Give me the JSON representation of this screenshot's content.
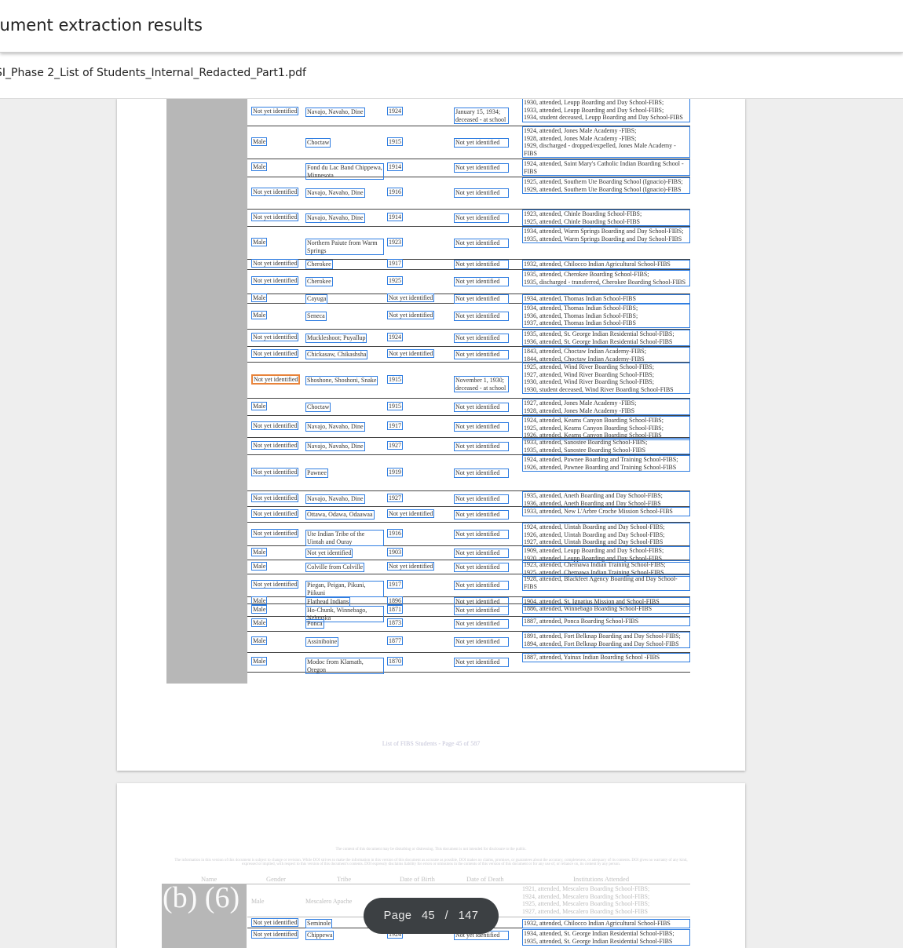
{
  "app": {
    "title": "cument extraction results"
  },
  "file": {
    "name": "SI_Phase 2_List of Students_Internal_Redacted_Part1.pdf"
  },
  "page1": {
    "rows": [
      {
        "gender": "Not yet identified",
        "tribe": "Navajo, Navaho, Dine",
        "birth": "1924",
        "death": "January 15, 1934; deceased - at school",
        "inst": [
          "1930, attended, Leupp Boarding and Day School-FIBS;",
          "1933, attended, Leupp Boarding and Day School-FIBS;",
          "1934, student deceased, Leupp Boarding and Day School-FIBS"
        ]
      },
      {
        "gender": "Male",
        "tribe": "Choctaw",
        "birth": "1915",
        "death": "Not yet identified",
        "inst": [
          "1924, attended, Jones Male Academy -FIBS;",
          "1928, attended, Jones Male Academy -FIBS;",
          "1929, discharged - dropped/expelled, Jones Male Academy -FIBS"
        ]
      },
      {
        "gender": "Male",
        "tribe": "Fond du Lac Band Chippewa, Minnesota",
        "birth": "1914",
        "death": "Not yet identified",
        "inst": [
          "1924, attended, Saint Mary's Catholic Indian Boarding School -FIBS"
        ]
      },
      {
        "gender": "Not yet identified",
        "tribe": "Navajo, Navaho, Dine",
        "birth": "1916",
        "death": "Not yet identified",
        "inst": [
          "1925, attended, Southern Ute Boarding School (Ignacio)-FIBS;",
          "1929, attended, Southern Ute Boarding School (Ignacio)-FIBS"
        ]
      },
      {
        "gender": "Not yet identified",
        "tribe": "Navajo, Navaho, Dine",
        "birth": "1914",
        "death": "Not yet identified",
        "inst": [
          "1923, attended, Chinle Boarding School-FIBS;",
          "1925, attended, Chinle Boarding School-FIBS"
        ]
      },
      {
        "gender": "Male",
        "tribe": "Northern Paiute from Warm Springs",
        "birth": "1923",
        "death": "Not yet identified",
        "inst": [
          "1934, attended, Warm Springs Boarding and Day School-FIBS;",
          "1935, attended, Warm Springs Boarding and Day School-FIBS"
        ]
      },
      {
        "gender": "Not yet identified",
        "tribe": "Cherokee",
        "birth": "1917",
        "death": "Not yet identified",
        "inst": [
          "1932, attended, Chilocco Indian Agricultural School-FIBS"
        ]
      },
      {
        "gender": "Not yet identified",
        "tribe": "Cherokee",
        "birth": "1925",
        "death": "Not yet identified",
        "inst": [
          "1935, attended, Cherokee Boarding School-FIBS;",
          "1935, discharged - transferred, Cherokee Boarding School-FIBS"
        ]
      },
      {
        "gender": "Male",
        "tribe": "Cayuga",
        "birth": "Not yet identified",
        "death": "Not yet identified",
        "inst": [
          "1934, attended, Thomas Indian School-FIBS"
        ]
      },
      {
        "gender": "Male",
        "tribe": "Seneca",
        "birth": "Not yet identified",
        "death": "Not yet identified",
        "inst": [
          "1934, attended, Thomas Indian School-FIBS;",
          "1936, attended, Thomas Indian School-FIBS;",
          "1937, attended, Thomas Indian School-FIBS"
        ]
      },
      {
        "gender": "Not yet identified",
        "tribe": "Muckleshoot; Puyallup",
        "birth": "1924",
        "death": "Not yet identified",
        "inst": [
          "1935, attended, St. George Indian Residential School-FIBS;",
          "1936, attended, St. George Indian Residential School-FIBS"
        ]
      },
      {
        "gender": "Not yet identified",
        "tribe": "Chickasaw, Chikashsha",
        "birth": "Not yet identified",
        "death": "Not yet identified",
        "inst": [
          "1843, attended, Choctaw Indian Academy-FIBS;",
          "1844, attended, Choctaw Indian Academy-FIBS"
        ]
      },
      {
        "gender": "Not yet identified",
        "tribe": "Shoshone, Shoshoni, Snake",
        "birth": "1915",
        "death": "November 1, 1930; deceased - at school",
        "inst": [
          "1925, attended, Wind River Boarding School-FIBS;",
          "1927, attended, Wind River Boarding School-FIBS;",
          "1930, attended, Wind River Boarding School-FIBS;",
          "1930, student deceased, Wind River Boarding School-FIBS"
        ]
      },
      {
        "gender": "Male",
        "tribe": "Choctaw",
        "birth": "1915",
        "death": "Not yet identified",
        "inst": [
          "1927, attended, Jones Male Academy -FIBS;",
          "1928, attended, Jones Male Academy -FIBS"
        ]
      },
      {
        "gender": "Not yet identified",
        "tribe": "Navajo, Navaho, Dine",
        "birth": "1917",
        "death": "Not yet identified",
        "inst": [
          "1924, attended, Keams Canyon Boarding School-FIBS;",
          "1925, attended, Keams Canyon Boarding School-FIBS;",
          "1926, attended, Keams Canyon Boarding School-FIBS"
        ]
      },
      {
        "gender": "Not yet identified",
        "tribe": "Navajo, Navaho, Dine",
        "birth": "1927",
        "death": "Not yet identified",
        "inst": [
          "1933, attended, Sanostee Boarding School-FIBS;",
          "1935, attended, Sanostee Boarding School-FIBS"
        ]
      },
      {
        "gender": "Not yet identified",
        "tribe": "Pawnee",
        "birth": "1919",
        "death": "Not yet identified",
        "inst": [
          "1924, attended, Pawnee Boarding and Training School-FIBS;",
          "1926, attended, Pawnee Boarding and Training School-FIBS"
        ]
      },
      {
        "gender": "Not yet identified",
        "tribe": "Navajo, Navaho, Dine",
        "birth": "1927",
        "death": "Not yet identified",
        "inst": [
          "1935, attended, Aneth Boarding and Day School-FIBS;",
          "1936, attended, Aneth Boarding and Day School-FIBS"
        ]
      },
      {
        "gender": "Not yet identified",
        "tribe": "Ottawa, Odawa, Odaawaa",
        "birth": "Not yet identified",
        "death": "Not yet identified",
        "inst": [
          "1933, attended, New L'Arbre Croche Mission School-FIBS"
        ]
      },
      {
        "gender": "Not yet identified",
        "tribe": "Ute Indian Tribe of the Uintah and Ouray",
        "birth": "1916",
        "death": "Not yet identified",
        "inst": [
          "1924, attended, Uintah Boarding and Day School-FIBS;",
          "1926, attended, Uintah Boarding and Day School-FIBS;",
          "1927, attended, Uintah Boarding and Day School-FIBS"
        ]
      },
      {
        "gender": "Male",
        "tribe": "Not yet identified",
        "birth": "1903",
        "death": "Not yet identified",
        "inst": [
          "1909, attended, Leupp Boarding and Day School-FIBS;",
          "1920, attended, Leupp Boarding and Day School-FIBS"
        ]
      },
      {
        "gender": "Male",
        "tribe": "Colville from Colville",
        "birth": "Not yet identified",
        "death": "Not yet identified",
        "inst": [
          "1923, attended, Chemawa Indian Training School-FIBS;",
          "1925, attended, Chemawa Indian Training School-FIBS"
        ]
      },
      {
        "gender": "Not yet identified",
        "tribe": "Piegan, Peigan, Pikuni, Piikuni",
        "birth": "1917",
        "death": "Not yet identified",
        "inst": [
          "1928, attended, Blackfeet Agency Boarding and Day School-FIBS"
        ]
      },
      {
        "gender": "Male",
        "tribe": "Flathead Indians",
        "birth": "1896",
        "death": "Not yet identified",
        "inst": [
          "1904, attended, St. Ignatius Mission and School-FIBS"
        ]
      },
      {
        "gender": "Male",
        "tribe": "Ho-Chunk, Winnebago, Nebraska",
        "birth": "1871",
        "death": "Not yet identified",
        "inst": [
          "1886, attended, Winnebago Boarding School-FIBS"
        ]
      },
      {
        "gender": "Male",
        "tribe": "Ponca",
        "birth": "1873",
        "death": "Not yet identified",
        "inst": [
          "1887, attended, Ponca Boarding School-FIBS"
        ]
      },
      {
        "gender": "Male",
        "tribe": "Assiniboine",
        "birth": "1877",
        "death": "Not yet identified",
        "inst": [
          "1891, attended, Fort Belknap Boarding and Day School-FIBS;",
          "1894, attended, Fort Belknap Boarding and Day School-FIBS"
        ]
      },
      {
        "gender": "Male",
        "tribe": "Modoc from Klamath, Oregon",
        "birth": "1870",
        "death": "Not yet identified",
        "inst": [
          "1887, attended, Yainax Indian Boarding School -FIBS"
        ]
      }
    ],
    "footer": "List of FIBS Students - Page 45 of 587"
  },
  "page2": {
    "notice1": "The content of this document may be disturbing or distressing. This document is not intended for disclosure to the public.",
    "notice2": "The information in this version of this document is subject to change or revision. While DOI strives to make the information in this version of this document as accurate as possible, DOI makes no claims, promises, or guarantees about the accuracy, completeness, or adequacy of its contents. DOI gives no warranty of any kind, expressed or implied, with respect to this version of this document's contents. DOI expressly disclaims liability for errors or omissions in the contents of this version of this document or for any use of, or reliance on, its content by any person.",
    "headers": {
      "name": "Name",
      "gender": "Gender",
      "tribe": "Tribe",
      "birth": "Date of Birth",
      "death": "Date of Death",
      "inst": "Institutions Attended"
    },
    "redaction": "(b) (6)",
    "row0": {
      "gender": "Male",
      "tribe": "Mescalero Apache",
      "inst": [
        "1921, attended, Mescalero Boarding School-FIBS;",
        "1924, attended, Mescalero Boarding School-FIBS;",
        "1925, attended, Mescalero Boarding School-FIBS;",
        "1927, attended, Mescalero Boarding School-FIBS"
      ]
    },
    "row1": {
      "gender": "Not yet identified",
      "tribe": "Seminole",
      "inst": "1932, attended, Chilocco Indian Agricultural School-FIBS"
    },
    "row2": {
      "gender": "Not yet identified",
      "tribe": "Chippewa",
      "birth": "1924",
      "death": "Not yet identified",
      "inst": [
        "1934, attended, St. George Indian Residential School-FIBS;",
        "1935, attended, St. George Indian Residential School-FIBS"
      ]
    }
  },
  "pager": {
    "label": "Page",
    "current": "45",
    "sep": "/",
    "total": "147"
  }
}
